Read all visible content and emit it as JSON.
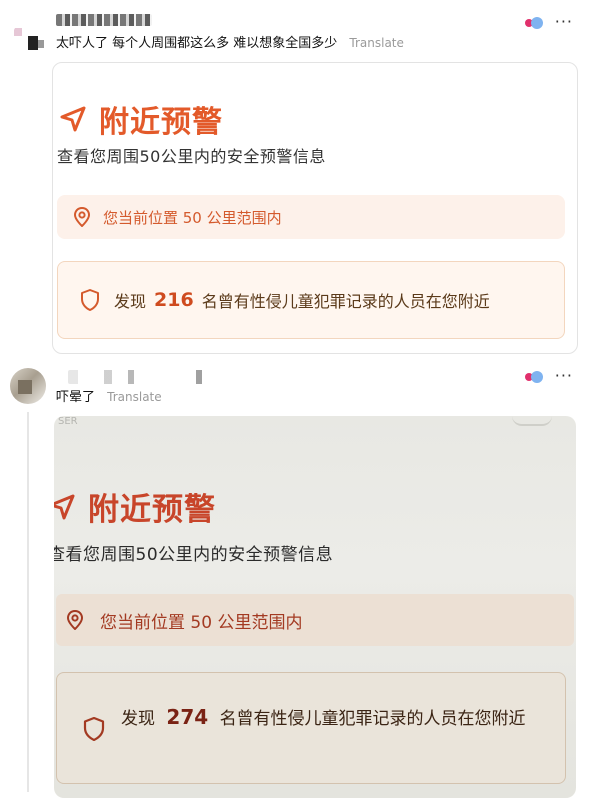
{
  "post1": {
    "comment": "太吓人了 每个人周围都这么多 难以想象全国多少",
    "translate_label": "Translate",
    "more_icon": "more-horizontal-icon",
    "screenshot": {
      "title": "附近预警",
      "subtitle": "查看您周围50公里内的安全预警信息",
      "location_text": "您当前位置 50 公里范围内",
      "alert_prefix": "发现",
      "alert_count": "216",
      "alert_suffix": "名曾有性侵儿童犯罪记录的人员在您附近",
      "accent_color": "#e35a2a"
    }
  },
  "post2": {
    "comment": "吓晕了",
    "translate_label": "Translate",
    "more_icon": "more-horizontal-icon",
    "screenshot": {
      "top_fragment": "SER",
      "title": "附近预警",
      "subtitle": "查看您周围50公里内的安全预警信息",
      "location_text": "您当前位置 50 公里范围内",
      "alert_prefix": "发现",
      "alert_count": "274",
      "alert_suffix": "名曾有性侵儿童犯罪记录的人员在您附近",
      "accent_color": "#c8452a"
    }
  }
}
